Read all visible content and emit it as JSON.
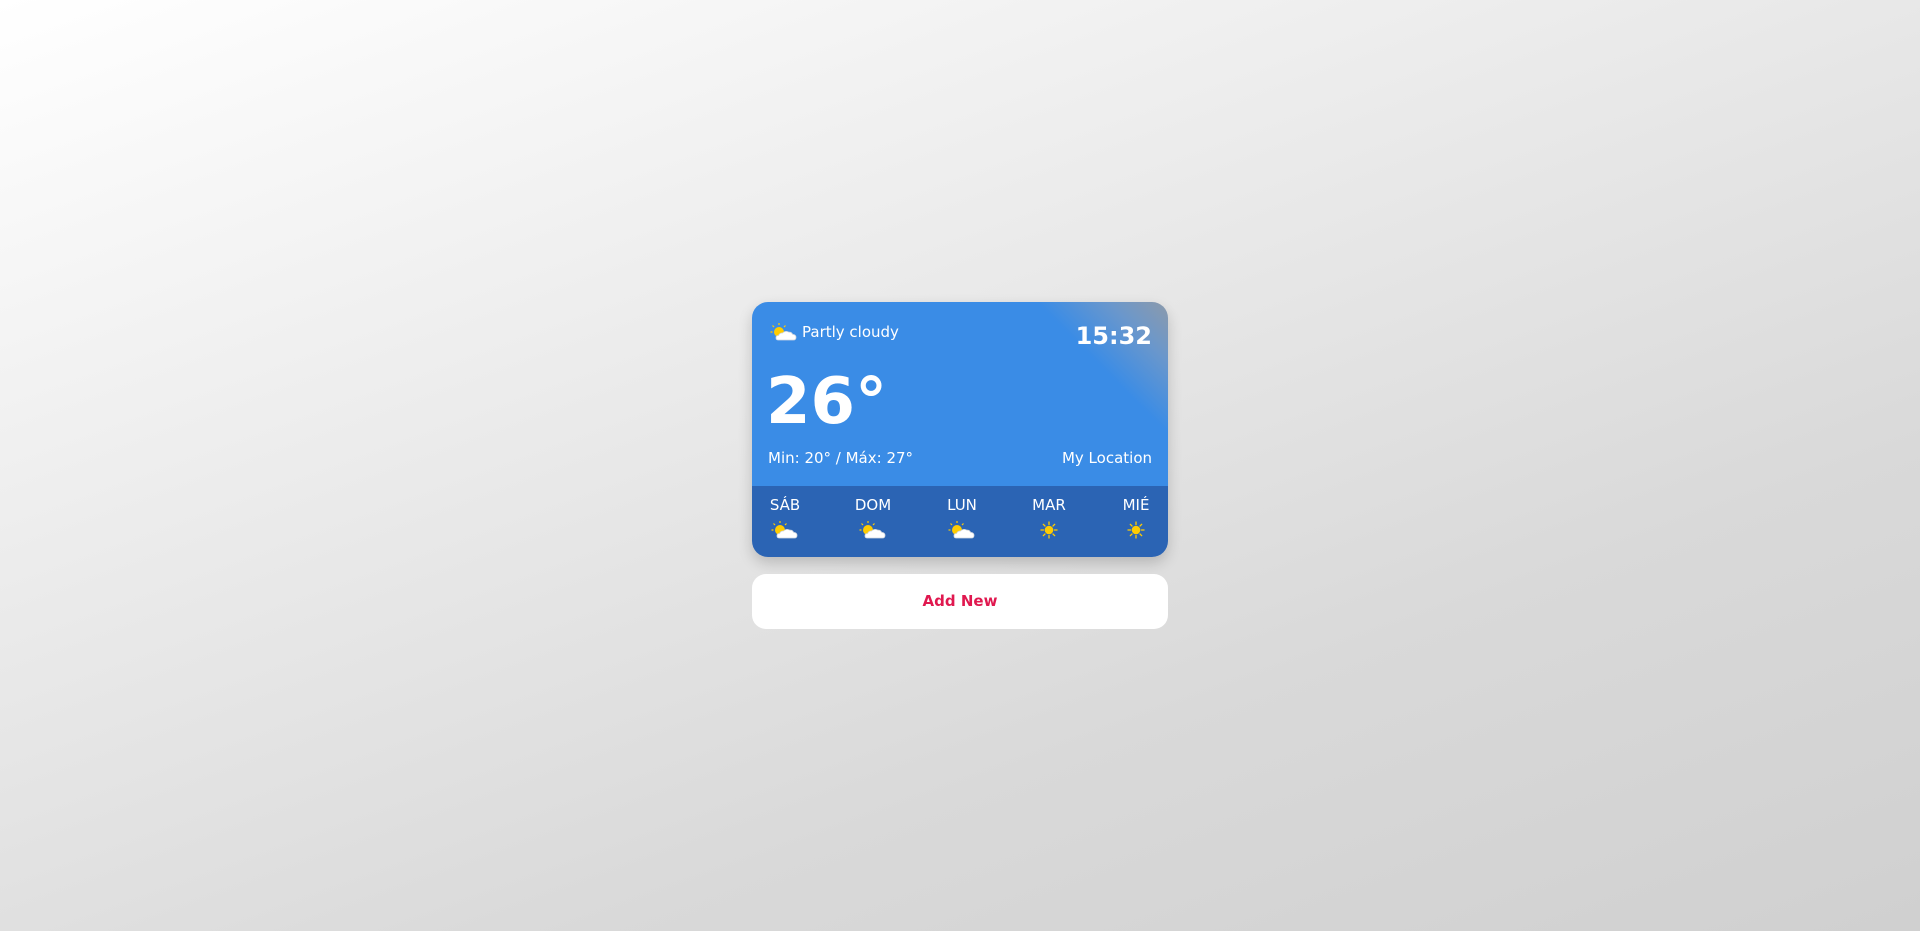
{
  "current": {
    "condition": "Partly cloudy",
    "condition_icon": "partly-cloudy-icon",
    "time": "15:32",
    "temperature": "26°",
    "min_max": "Min: 20° / Máx: 27°",
    "location": "My Location"
  },
  "forecast": [
    {
      "day": "SÁB",
      "icon": "partly-cloudy-icon"
    },
    {
      "day": "DOM",
      "icon": "partly-cloudy-icon"
    },
    {
      "day": "LUN",
      "icon": "partly-cloudy-icon"
    },
    {
      "day": "MAR",
      "icon": "sun-icon"
    },
    {
      "day": "MIÉ",
      "icon": "sun-icon"
    }
  ],
  "actions": {
    "add_new_label": "Add New"
  },
  "colors": {
    "card_blue": "#3a8ce6",
    "forecast_blue": "#2b64b4",
    "add_new_text": "#e0184f",
    "sun_yellow": "#ffcc00"
  }
}
